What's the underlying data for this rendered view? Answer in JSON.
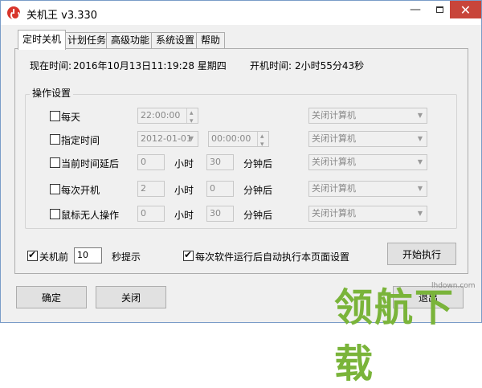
{
  "window": {
    "title": "关机王 v3.330",
    "min_glyph": "—",
    "close_glyph": "✕"
  },
  "tabs": [
    {
      "label": "定时关机",
      "active": true
    },
    {
      "label": "计划任务",
      "active": false
    },
    {
      "label": "高级功能",
      "active": false
    },
    {
      "label": "系统设置",
      "active": false
    },
    {
      "label": "帮助",
      "active": false
    }
  ],
  "status": {
    "now_label": "现在时间:",
    "now_value": "2016年10月13日11:19:28 星期四",
    "uptime_label": "开机时间:",
    "uptime_value": "2小时55分43秒"
  },
  "ops": {
    "group_title": "操作设置",
    "action_default": "关闭计算机",
    "rows": [
      {
        "label": "每天",
        "time": "22:00:00"
      },
      {
        "label": "指定时间",
        "date": "2012-01-01",
        "time": "00:00:00"
      },
      {
        "label": "当前时间延后",
        "hours": "0",
        "hours_unit": "小时",
        "minutes": "30",
        "minutes_unit": "分钟后"
      },
      {
        "label": "每次开机",
        "hours": "2",
        "hours_unit": "小时",
        "minutes": "0",
        "minutes_unit": "分钟后"
      },
      {
        "label": "鼠标无人操作",
        "hours": "0",
        "hours_unit": "小时",
        "minutes": "30",
        "minutes_unit": "分钟后"
      }
    ]
  },
  "bottom": {
    "before_label": "关机前",
    "before_value": "10",
    "before_suffix": "秒提示",
    "auto_label": "每次软件运行后自动执行本页面设置",
    "start_button": "开始执行"
  },
  "footer": {
    "ok_button": "确定",
    "close_button": "关闭",
    "exit_button": "退出"
  },
  "watermark": {
    "big": "领航下载",
    "small": "lhdown.com"
  }
}
